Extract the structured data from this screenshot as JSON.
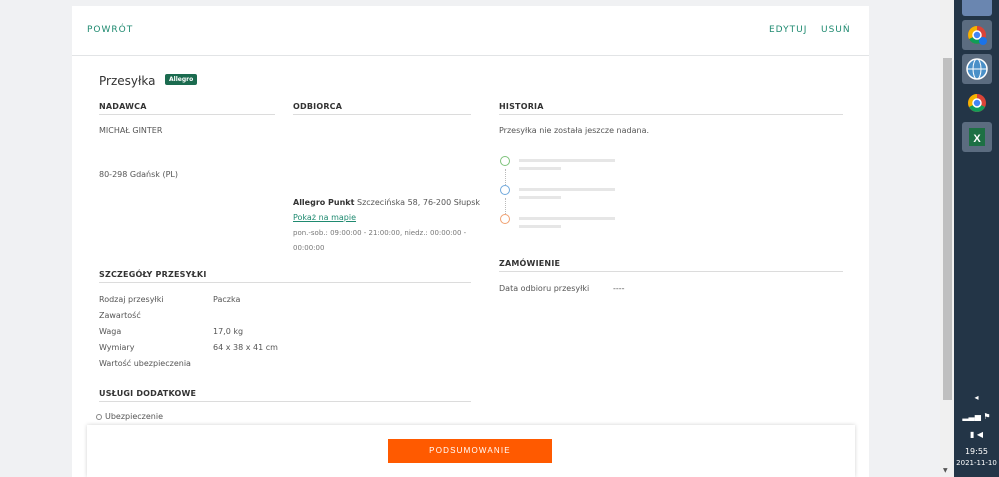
{
  "nav": {
    "back": "POWRÓT",
    "edit": "EDYTUJ",
    "delete": "USUŃ"
  },
  "shipment": {
    "title": "Przesyłka",
    "badge": "Allegro"
  },
  "sender": {
    "heading": "NADAWCA",
    "name": "MICHAŁ GINTER",
    "address": "80-298 Gdańsk (PL)"
  },
  "recipient": {
    "heading": "ODBIORCA",
    "point_name": "Allegro Punkt",
    "point_address": "Szczecińska 58, 76-200 Słupsk",
    "map_link": "Pokaż na mapie",
    "hours_line1": "pon.-sob.: 09:00:00 - 21:00:00, niedz.: 00:00:00 -",
    "hours_line2": "00:00:00"
  },
  "history": {
    "heading": "HISTORIA",
    "status": "Przesyłka nie została jeszcze nadana.",
    "dot_colors": [
      "#7dc27a",
      "#6fa8dc",
      "#f0a070"
    ]
  },
  "details": {
    "heading": "SZCZEGÓŁY PRZESYŁKI",
    "rows": [
      {
        "label": "Rodzaj przesyłki",
        "value": "Paczka"
      },
      {
        "label": "Zawartość",
        "value": ""
      },
      {
        "label": "Waga",
        "value": "17,0 kg"
      },
      {
        "label": "Wymiary",
        "value": "64 x 38 x 41 cm"
      },
      {
        "label": "Wartość ubezpieczenia",
        "value": ""
      }
    ]
  },
  "order": {
    "heading": "ZAMÓWIENIE",
    "pickup_label": "Data odbioru przesyłki",
    "pickup_value": "----"
  },
  "extras": {
    "heading": "USŁUGI DODATKOWE",
    "insurance": "Ubezpieczenie"
  },
  "footer": {
    "summary_button": "PODSUMOWANIE"
  },
  "taskbar": {
    "time": "19:55",
    "date": "2021-11-10"
  }
}
